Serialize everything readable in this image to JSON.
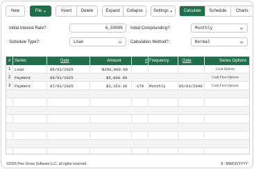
{
  "toolbar": {
    "new": "New",
    "file": "File",
    "insert": "Insert",
    "delete": "Delete",
    "expand": "Expand",
    "collapse": "Collapse",
    "settings": "Settings",
    "calculate": "Calculate",
    "schedule": "Schedule",
    "charts": "Charts",
    "active_view": "Calculate"
  },
  "form": {
    "initial_interest_rate_label": "Initial Interest Rate?:",
    "initial_interest_rate_value": "6.5000%",
    "initial_compounding_label": "Initial Compounding?:",
    "initial_compounding_value": "Monthly",
    "schedule_type_label": "Schedule Type?:",
    "schedule_type_value": "Loan",
    "calculation_method_label": "Calculation Method?:",
    "calculation_method_value": "Normal"
  },
  "table": {
    "columns": [
      "#",
      "Series",
      "Date",
      "Amount",
      "#",
      "Frequency",
      "Date",
      "Series Options"
    ],
    "rows": [
      {
        "num": "1",
        "series": "Loan",
        "date": "05/01/2025",
        "amount": "$250,000.00",
        "count": "",
        "frequency": "",
        "end_date": "",
        "options": "Loan Options"
      },
      {
        "num": "2",
        "series": "Payment",
        "date": "06/01/2025",
        "amount": "$5,000.00",
        "count": "",
        "frequency": "",
        "end_date": "",
        "options": "Cash Flow Options"
      },
      {
        "num": "3",
        "series": "Payment",
        "date": "07/01/2025",
        "amount": "$2,153.10",
        "count": "179",
        "frequency": "Monthly",
        "end_date": "05/01/2040",
        "options": "Cash Flow Options"
      }
    ]
  },
  "footer": {
    "copyright": "©2025 Pine Grove Software LLC, all rights reserved",
    "format": "$ : MM/DD/YYYY"
  },
  "colors": {
    "accent": "#1f6f4a",
    "border": "#c9c9c9",
    "row_alt": "#f4f4f4"
  }
}
